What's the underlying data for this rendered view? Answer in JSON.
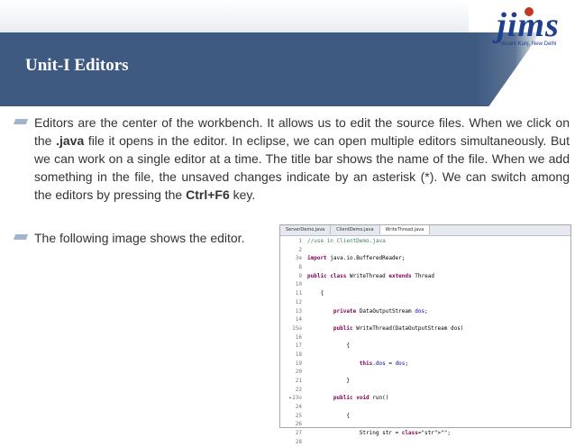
{
  "slide": {
    "title": "Unit-I Editors",
    "logo": {
      "word": "jims",
      "tagline": "Vasant Kunj, New Delhi"
    },
    "bullets": [
      {
        "p1": "Editors are the center of the workbench. It allows us to edit the source files. When we click on the ",
        "b1": ".java",
        "p2": " file it opens in the editor. In eclipse, we can open multiple editors simultaneously. But we can work on a single editor at a time. The title bar shows the name of the file. When we add something in the file, the unsaved changes indicate by an asterisk (*). We can switch among the editors by pressing the ",
        "b2": "Ctrl+F6",
        "p3": " key."
      },
      {
        "text": "The following image shows the editor."
      }
    ]
  },
  "editor": {
    "tabs": [
      "ServerDemo.java",
      "ClientDemo.java",
      "WriteThread.java"
    ],
    "active_tab": 2,
    "lines": [
      {
        "n": "1",
        "code": "//use in ClientDemo.java",
        "kind": "comment"
      },
      {
        "n": "2",
        "code": ""
      },
      {
        "n": "3⊕",
        "code": "import java.io.BufferedReader;",
        "kind": "import"
      },
      {
        "n": "8",
        "code": ""
      },
      {
        "n": "9",
        "code": "public class WriteThread extends Thread",
        "kind": "class"
      },
      {
        "n": "10",
        "code": ""
      },
      {
        "n": "11",
        "code": "    {"
      },
      {
        "n": "12",
        "code": ""
      },
      {
        "n": "13",
        "code": "        private DataOutputStream dos;",
        "kind": "field"
      },
      {
        "n": "14",
        "code": ""
      },
      {
        "n": "15⊖",
        "code": "        public WriteThread(DataOutputStream dos)",
        "kind": "ctor"
      },
      {
        "n": "16",
        "code": ""
      },
      {
        "n": "17",
        "code": "            {"
      },
      {
        "n": "18",
        "code": ""
      },
      {
        "n": "19",
        "code": "                this.dos = dos;",
        "kind": "assign"
      },
      {
        "n": "20",
        "code": ""
      },
      {
        "n": "21",
        "code": "            }"
      },
      {
        "n": "22",
        "code": ""
      },
      {
        "n": "▸23⊖",
        "code": "        public void run()",
        "kind": "method"
      },
      {
        "n": "24",
        "code": ""
      },
      {
        "n": "25",
        "code": "            {"
      },
      {
        "n": "26",
        "code": ""
      },
      {
        "n": "27",
        "code": "                String str = \"\";",
        "kind": "string"
      },
      {
        "n": "28",
        "code": ""
      }
    ]
  }
}
